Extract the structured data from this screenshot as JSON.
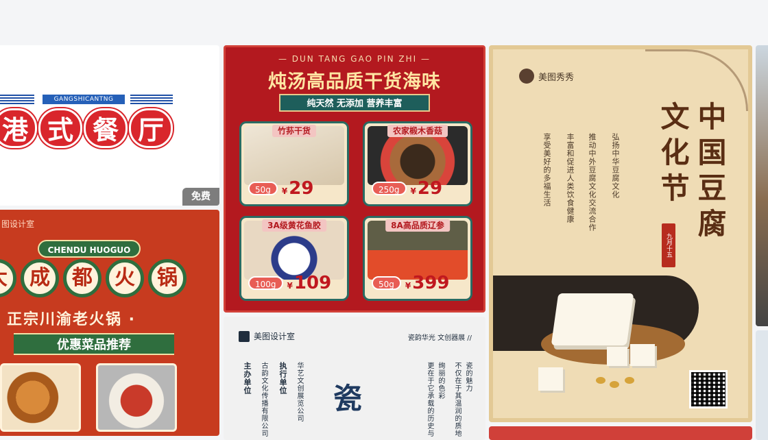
{
  "cards": {
    "hk_restaurant": {
      "en_label": "GANGSHICANTNG",
      "title_chars": [
        "港",
        "式",
        "餐",
        "厅"
      ],
      "badge": "免费"
    },
    "hotpot": {
      "studio": "图设计室",
      "en_label": "CHENDU HUOGUO",
      "title_chars": [
        "大",
        "成",
        "都",
        "火",
        "锅"
      ],
      "subtitle": "正宗川渝老火锅 ·",
      "promo": "优惠菜品推荐"
    },
    "seafood": {
      "en_label": "— DUN TANG GAO PIN ZHI —",
      "title": "炖汤高品质干货海味",
      "ribbon": "纯天然 无添加 营养丰富",
      "currency": "¥",
      "products": [
        {
          "name": "竹荪干货",
          "weight": "50g",
          "price": "29"
        },
        {
          "name": "农家椴木香菇",
          "weight": "250g",
          "price": "29"
        },
        {
          "name": "3A级黄花鱼胶",
          "weight": "100g",
          "price": "109"
        },
        {
          "name": "8A高品质辽参",
          "weight": "50g",
          "price": "399"
        }
      ]
    },
    "porcelain": {
      "logo": "美图设计室",
      "motto": "瓷韵华光 文创器展 //",
      "col_host_label": "主办单位",
      "col_host": "古韵文化传播有限公司",
      "col_exec_label": "执行单位",
      "col_exec": "华艺文创展览公司",
      "col_text1": "瓷的魅力",
      "col_text2": "不仅在于其温润的质地",
      "col_text3": "绚丽的色彩",
      "col_text4": "更在于它承载的历史与",
      "big": "瓷"
    },
    "tofu": {
      "brand": "美图秀秀",
      "vt1": "弘扬中华豆腐文化",
      "vt2": "推动中外豆腐文化交流合作",
      "vt3": "丰富和促进人类饮食健康",
      "vt4": "享受美好的多福生活",
      "big_left": "文化节",
      "big_right": "中国豆腐",
      "seal": "九月十五"
    }
  }
}
